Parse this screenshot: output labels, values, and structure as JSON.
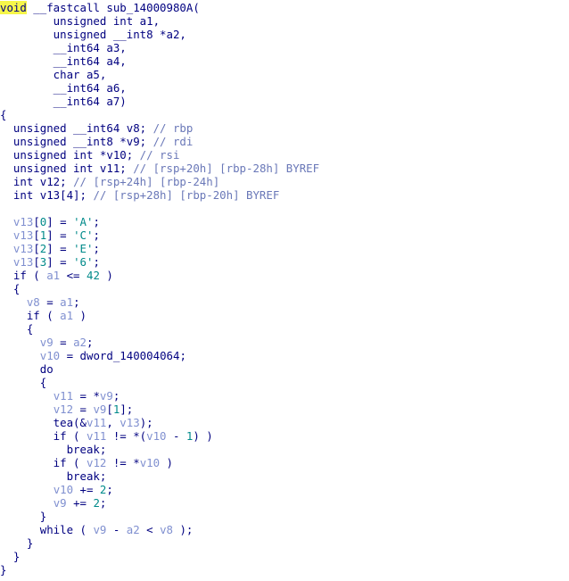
{
  "colors": {
    "background": "#ffffff",
    "code_text": "#000080",
    "comment": "#6a78b8",
    "local_variable": "#8090d0",
    "literal": "#008a8a",
    "highlight": "#f6f64a"
  },
  "code": {
    "lines": [
      [
        {
          "t": "void",
          "k": "highlight"
        },
        {
          "t": " __fastcall sub_14000980A(",
          "k": "text"
        }
      ],
      [
        {
          "t": "        unsigned int a1,",
          "k": "text"
        }
      ],
      [
        {
          "t": "        unsigned __int8 *a2,",
          "k": "text"
        }
      ],
      [
        {
          "t": "        __int64 a3,",
          "k": "text"
        }
      ],
      [
        {
          "t": "        __int64 a4,",
          "k": "text"
        }
      ],
      [
        {
          "t": "        char a5,",
          "k": "text"
        }
      ],
      [
        {
          "t": "        __int64 a6,",
          "k": "text"
        }
      ],
      [
        {
          "t": "        __int64 a7)",
          "k": "text"
        }
      ],
      [
        {
          "t": "{",
          "k": "text"
        }
      ],
      [
        {
          "t": "  unsigned __int64 v8; ",
          "k": "text"
        },
        {
          "t": "// rbp",
          "k": "comment"
        }
      ],
      [
        {
          "t": "  unsigned __int8 *v9; ",
          "k": "text"
        },
        {
          "t": "// rdi",
          "k": "comment"
        }
      ],
      [
        {
          "t": "  unsigned int *v10; ",
          "k": "text"
        },
        {
          "t": "// rsi",
          "k": "comment"
        }
      ],
      [
        {
          "t": "  unsigned int v11; ",
          "k": "text"
        },
        {
          "t": "// [rsp+20h] [rbp-28h] BYREF",
          "k": "comment"
        }
      ],
      [
        {
          "t": "  int v12; ",
          "k": "text"
        },
        {
          "t": "// [rsp+24h] [rbp-24h]",
          "k": "comment"
        }
      ],
      [
        {
          "t": "  int v13[4]; ",
          "k": "text"
        },
        {
          "t": "// [rsp+28h] [rbp-20h] BYREF",
          "k": "comment"
        }
      ],
      [
        {
          "t": "",
          "k": "text"
        }
      ],
      [
        {
          "t": "  ",
          "k": "text"
        },
        {
          "t": "v13",
          "k": "var"
        },
        {
          "t": "[",
          "k": "text"
        },
        {
          "t": "0",
          "k": "number"
        },
        {
          "t": "] = ",
          "k": "text"
        },
        {
          "t": "'A'",
          "k": "char"
        },
        {
          "t": ";",
          "k": "text"
        }
      ],
      [
        {
          "t": "  ",
          "k": "text"
        },
        {
          "t": "v13",
          "k": "var"
        },
        {
          "t": "[",
          "k": "text"
        },
        {
          "t": "1",
          "k": "number"
        },
        {
          "t": "] = ",
          "k": "text"
        },
        {
          "t": "'C'",
          "k": "char"
        },
        {
          "t": ";",
          "k": "text"
        }
      ],
      [
        {
          "t": "  ",
          "k": "text"
        },
        {
          "t": "v13",
          "k": "var"
        },
        {
          "t": "[",
          "k": "text"
        },
        {
          "t": "2",
          "k": "number"
        },
        {
          "t": "] = ",
          "k": "text"
        },
        {
          "t": "'E'",
          "k": "char"
        },
        {
          "t": ";",
          "k": "text"
        }
      ],
      [
        {
          "t": "  ",
          "k": "text"
        },
        {
          "t": "v13",
          "k": "var"
        },
        {
          "t": "[",
          "k": "text"
        },
        {
          "t": "3",
          "k": "number"
        },
        {
          "t": "] = ",
          "k": "text"
        },
        {
          "t": "'6'",
          "k": "char"
        },
        {
          "t": ";",
          "k": "text"
        }
      ],
      [
        {
          "t": "  if ( ",
          "k": "text"
        },
        {
          "t": "a1",
          "k": "var"
        },
        {
          "t": " <= ",
          "k": "text"
        },
        {
          "t": "42",
          "k": "number"
        },
        {
          "t": " )",
          "k": "text"
        }
      ],
      [
        {
          "t": "  {",
          "k": "text"
        }
      ],
      [
        {
          "t": "    ",
          "k": "text"
        },
        {
          "t": "v8",
          "k": "var"
        },
        {
          "t": " = ",
          "k": "text"
        },
        {
          "t": "a1",
          "k": "var"
        },
        {
          "t": ";",
          "k": "text"
        }
      ],
      [
        {
          "t": "    if ( ",
          "k": "text"
        },
        {
          "t": "a1",
          "k": "var"
        },
        {
          "t": " )",
          "k": "text"
        }
      ],
      [
        {
          "t": "    {",
          "k": "text"
        }
      ],
      [
        {
          "t": "      ",
          "k": "text"
        },
        {
          "t": "v9",
          "k": "var"
        },
        {
          "t": " = ",
          "k": "text"
        },
        {
          "t": "a2",
          "k": "var"
        },
        {
          "t": ";",
          "k": "text"
        }
      ],
      [
        {
          "t": "      ",
          "k": "text"
        },
        {
          "t": "v10",
          "k": "var"
        },
        {
          "t": " = ",
          "k": "text"
        },
        {
          "t": "dword_140004064",
          "k": "global"
        },
        {
          "t": ";",
          "k": "text"
        }
      ],
      [
        {
          "t": "      do",
          "k": "text"
        }
      ],
      [
        {
          "t": "      {",
          "k": "text"
        }
      ],
      [
        {
          "t": "        ",
          "k": "text"
        },
        {
          "t": "v11",
          "k": "var"
        },
        {
          "t": " = *",
          "k": "text"
        },
        {
          "t": "v9",
          "k": "var"
        },
        {
          "t": ";",
          "k": "text"
        }
      ],
      [
        {
          "t": "        ",
          "k": "text"
        },
        {
          "t": "v12",
          "k": "var"
        },
        {
          "t": " = ",
          "k": "text"
        },
        {
          "t": "v9",
          "k": "var"
        },
        {
          "t": "[",
          "k": "text"
        },
        {
          "t": "1",
          "k": "number"
        },
        {
          "t": "];",
          "k": "text"
        }
      ],
      [
        {
          "t": "        tea(&",
          "k": "text"
        },
        {
          "t": "v11",
          "k": "var"
        },
        {
          "t": ", ",
          "k": "text"
        },
        {
          "t": "v13",
          "k": "var"
        },
        {
          "t": ");",
          "k": "text"
        }
      ],
      [
        {
          "t": "        if ( ",
          "k": "text"
        },
        {
          "t": "v11",
          "k": "var"
        },
        {
          "t": " != *(",
          "k": "text"
        },
        {
          "t": "v10",
          "k": "var"
        },
        {
          "t": " - ",
          "k": "text"
        },
        {
          "t": "1",
          "k": "number"
        },
        {
          "t": ") )",
          "k": "text"
        }
      ],
      [
        {
          "t": "          break;",
          "k": "text"
        }
      ],
      [
        {
          "t": "        if ( ",
          "k": "text"
        },
        {
          "t": "v12",
          "k": "var"
        },
        {
          "t": " != *",
          "k": "text"
        },
        {
          "t": "v10",
          "k": "var"
        },
        {
          "t": " )",
          "k": "text"
        }
      ],
      [
        {
          "t": "          break;",
          "k": "text"
        }
      ],
      [
        {
          "t": "        ",
          "k": "text"
        },
        {
          "t": "v10",
          "k": "var"
        },
        {
          "t": " += ",
          "k": "text"
        },
        {
          "t": "2",
          "k": "number"
        },
        {
          "t": ";",
          "k": "text"
        }
      ],
      [
        {
          "t": "        ",
          "k": "text"
        },
        {
          "t": "v9",
          "k": "var"
        },
        {
          "t": " += ",
          "k": "text"
        },
        {
          "t": "2",
          "k": "number"
        },
        {
          "t": ";",
          "k": "text"
        }
      ],
      [
        {
          "t": "      }",
          "k": "text"
        }
      ],
      [
        {
          "t": "      while ( ",
          "k": "text"
        },
        {
          "t": "v9",
          "k": "var"
        },
        {
          "t": " - ",
          "k": "text"
        },
        {
          "t": "a2",
          "k": "var"
        },
        {
          "t": " < ",
          "k": "text"
        },
        {
          "t": "v8",
          "k": "var"
        },
        {
          "t": " );",
          "k": "text"
        }
      ],
      [
        {
          "t": "    }",
          "k": "text"
        }
      ],
      [
        {
          "t": "  }",
          "k": "text"
        }
      ],
      [
        {
          "t": "}",
          "k": "text"
        }
      ]
    ]
  }
}
